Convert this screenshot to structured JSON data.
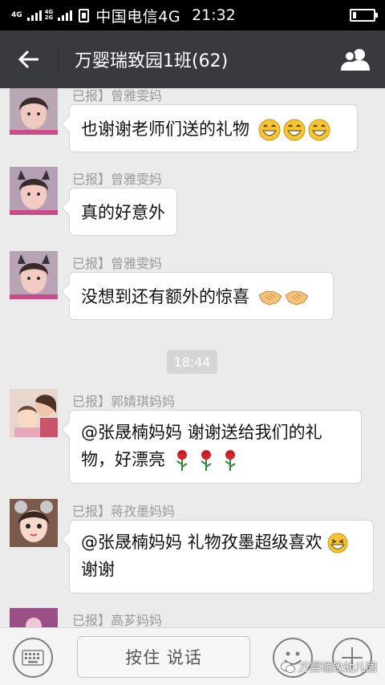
{
  "status_bar": {
    "network_top": "4G",
    "network_bottom": "2G",
    "network_top_small": "4G",
    "network_bottom_small": "2G",
    "carrier": "中国电信4G",
    "time": "21:32",
    "battery_level": 0.15
  },
  "header": {
    "title": "万婴瑞致园1班(62)",
    "back_icon": "back-arrow-icon",
    "members_icon": "group-members-icon"
  },
  "messages": [
    {
      "sender": "已报】曾雅雯妈",
      "text": "也谢谢老师们送的礼物",
      "emoji": "grin-emoji ×3"
    },
    {
      "sender": "已报】曾雅雯妈",
      "text": "真的好意外"
    },
    {
      "sender": "已报】曾雅雯妈",
      "text": "没想到还有额外的惊喜",
      "emoji": "handshake-emoji ×2"
    },
    {
      "sender": "已报】郭婧琪妈妈",
      "line1": "@张晟楠妈妈 谢谢送给我们的礼",
      "line2": "物，好漂亮",
      "emoji": "rose-emoji ×3"
    },
    {
      "sender": "已报】蒋孜墨妈妈",
      "line1": "@张晟楠妈妈 礼物孜墨超级喜欢",
      "line2": "谢谢",
      "emoji": "laughing-emoji"
    },
    {
      "sender": "已报】高芗妈妈"
    }
  ],
  "time_divider": "18:44",
  "input_bar": {
    "voice_label": "按住 说话",
    "keyboard_icon": "keyboard-icon",
    "emoji_icon": "emoji-face-icon",
    "plus_icon": "plus-icon"
  },
  "watermark": "万婴瑞致幼儿园"
}
